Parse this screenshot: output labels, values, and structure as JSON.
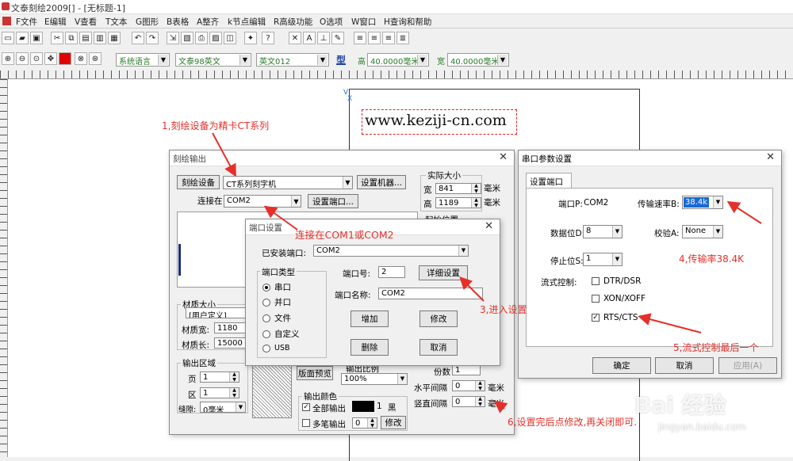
{
  "window": {
    "title": "文泰刻绘2009[] - [无标题-1]"
  },
  "menu": [
    "F文件",
    "E编辑",
    "V查看",
    "T文本",
    "G图形",
    "B表格",
    "A整齐",
    "k节点编辑",
    "R高级功能",
    "O选项",
    "W窗口",
    "H查询和帮助"
  ],
  "toolbar2": {
    "lang": "系统语言",
    "font1": "文泰98英文",
    "font2": "英文012",
    "type_icon": "型",
    "h_label": "高",
    "h_value": "40.0000毫米",
    "w_label": "宽",
    "w_value": "40.0000毫米"
  },
  "canvas": {
    "axis_v": "V",
    "axis_x": "X",
    "sample_text": "www.keziji-cn.com"
  },
  "plot_dialog": {
    "title": "刻绘输出",
    "device_btn": "刻绘设备",
    "device_value": "CT系列刻字机",
    "setup_machine": "设置机器...",
    "connect_label": "连接在",
    "connect_value": "COM2",
    "port_setup_btn": "设置端口...",
    "actual_size": "实际大小",
    "width_label": "宽",
    "width_value": "841",
    "height_label": "高",
    "height_value": "1189",
    "unit": "毫米",
    "start_pos": "起始位置",
    "material_size": "材质大小",
    "material_type": "[用户定义]",
    "mat_w_label": "材质宽:",
    "mat_w_value": "1180",
    "mat_h_label": "材质长:",
    "mat_h_value": "15000",
    "output_area": "输出区域",
    "page_label": "页",
    "page_value": "1",
    "zone_label": "区",
    "zone_value": "1",
    "gap_label": "缝隙:",
    "gap_value": "0毫米",
    "preview_btn": "版面预览",
    "scale_label": "输出比例",
    "scale_value": "100%",
    "copies_label": "份数",
    "copies_value": "1",
    "hgap_label": "水平间隔",
    "hgap_value": "0",
    "vgap_label": "竖直间隔",
    "vgap_value": "0",
    "mm": "毫米",
    "color_group": "输出颜色",
    "all_output": "全部输出",
    "color_num": "1",
    "color_name": "黑",
    "multi_pen": "多笔输出",
    "multi_value": "0",
    "modify_btn": "修改"
  },
  "port_dialog": {
    "title": "端口设置",
    "installed_label": "已安装端口:",
    "installed_value": "COM2",
    "type_group": "端口类型",
    "types": [
      "串口",
      "并口",
      "文件",
      "自定义",
      "USB"
    ],
    "port_no_label": "端口号:",
    "port_no_value": "2",
    "detail_btn": "详细设置",
    "port_name_label": "端口名称:",
    "port_name_value": "COM2",
    "add_btn": "增加",
    "modify_btn": "修改",
    "delete_btn": "删除",
    "cancel_btn": "取消"
  },
  "serial_dialog": {
    "title": "串口参数设置",
    "tab": "设置端口",
    "port_label": "端口P:",
    "port_value": "COM2",
    "baud_label": "传输速率B:",
    "baud_value": "38.4k",
    "databits_label": "数据位D:",
    "databits_value": "8",
    "parity_label": "校验A:",
    "parity_value": "None",
    "stopbits_label": "停止位S:",
    "stopbits_value": "1",
    "flow_label": "流式控制:",
    "flow_options": [
      {
        "label": "DTR/DSR",
        "checked": false
      },
      {
        "label": "XON/XOFF",
        "checked": false
      },
      {
        "label": "RTS/CTS",
        "checked": true
      }
    ],
    "ok_btn": "确定",
    "cancel_btn": "取消",
    "apply_btn": "应用(A)"
  },
  "annotations": {
    "a1": "1,刻绘设备为精卡CT系列",
    "a2": "连接在COM1或COM2",
    "a3": "3,进入设置",
    "a4": "4,传输率38.4K",
    "a5": "5,流式控制最后一个",
    "a6": "6,设置完后点修改,再关闭即可."
  },
  "watermark": {
    "brand": "Bai 经验",
    "url": "jingyan.baidu.com"
  }
}
